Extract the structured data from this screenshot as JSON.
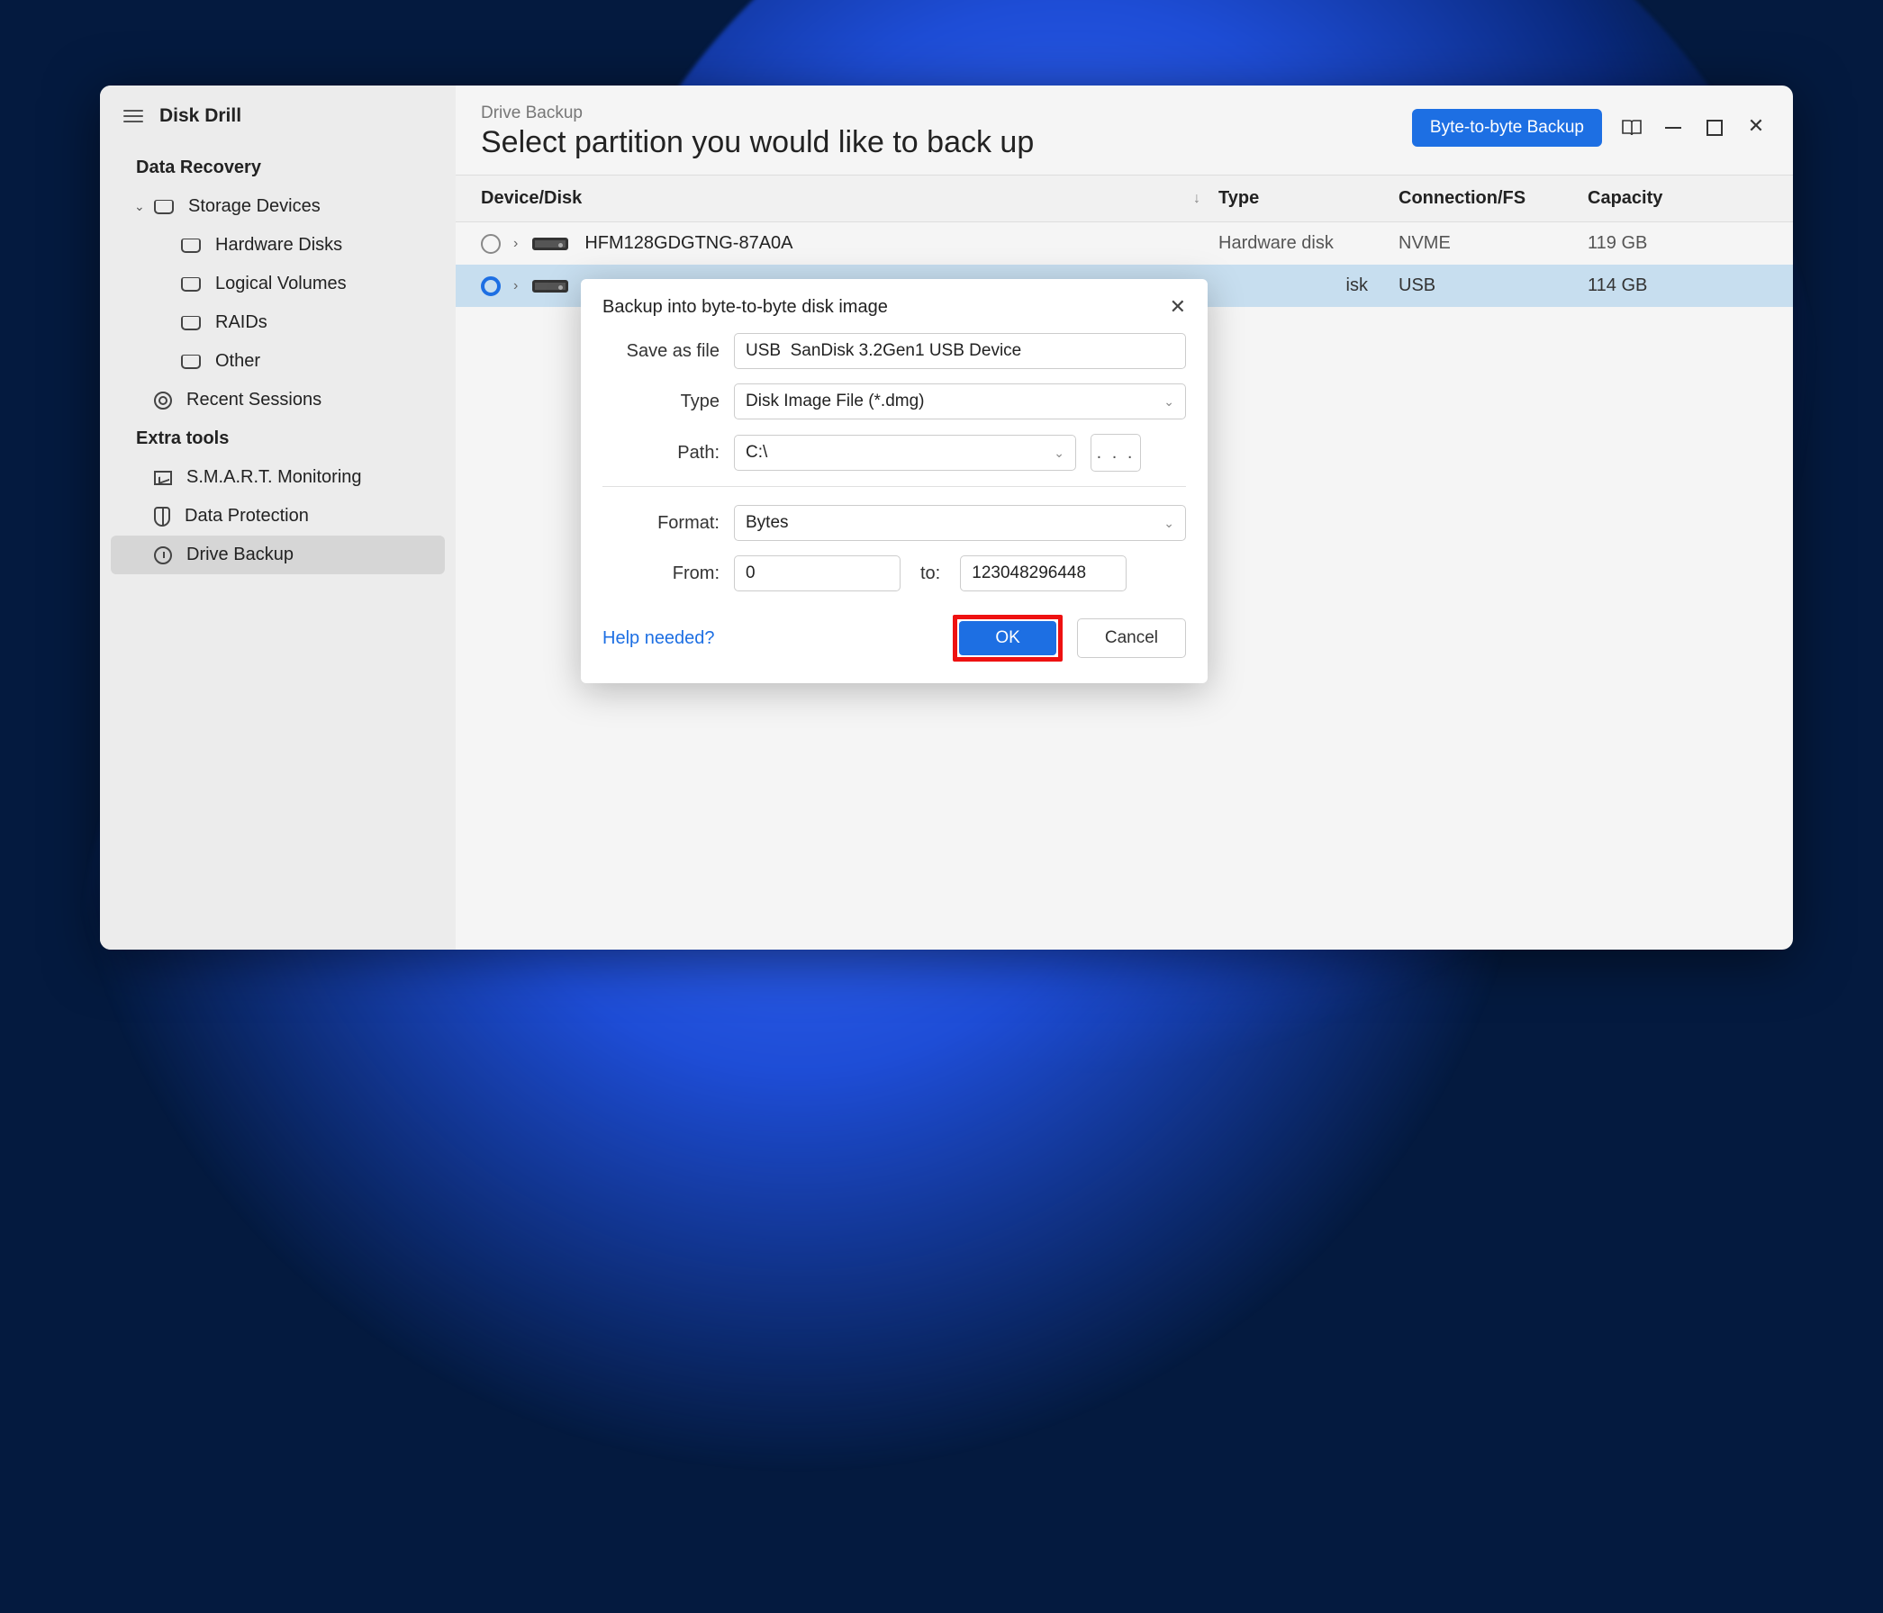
{
  "app": {
    "title": "Disk Drill"
  },
  "sidebar": {
    "sections": {
      "data_recovery_label": "Data Recovery",
      "extra_tools_label": "Extra tools"
    },
    "items": {
      "storage_devices": "Storage Devices",
      "hardware_disks": "Hardware Disks",
      "logical_volumes": "Logical Volumes",
      "raids": "RAIDs",
      "other": "Other",
      "recent_sessions": "Recent Sessions",
      "smart": "S.M.A.R.T. Monitoring",
      "data_protection": "Data Protection",
      "drive_backup": "Drive Backup"
    }
  },
  "header": {
    "breadcrumb": "Drive Backup",
    "title": "Select partition you would like to back up",
    "primary_button": "Byte-to-byte Backup"
  },
  "table": {
    "columns": {
      "device": "Device/Disk",
      "type": "Type",
      "connection": "Connection/FS",
      "capacity": "Capacity"
    },
    "rows": [
      {
        "name": "HFM128GDGTNG-87A0A",
        "type": "Hardware disk",
        "connection": "NVME",
        "capacity": "119 GB",
        "selected": false
      },
      {
        "name": "",
        "type": "isk",
        "connection": "USB",
        "capacity": "114 GB",
        "selected": true
      }
    ]
  },
  "modal": {
    "title": "Backup into byte-to-byte disk image",
    "labels": {
      "save_as": "Save as file",
      "type": "Type",
      "path": "Path:",
      "format": "Format:",
      "from": "From:",
      "to": "to:"
    },
    "values": {
      "filename": "USB  SanDisk 3.2Gen1 USB Device",
      "type": "Disk Image File (*.dmg)",
      "path": "C:\\",
      "format": "Bytes",
      "from": "0",
      "to": "123048296448"
    },
    "buttons": {
      "browse": ". . .",
      "help": "Help needed?",
      "ok": "OK",
      "cancel": "Cancel"
    }
  }
}
